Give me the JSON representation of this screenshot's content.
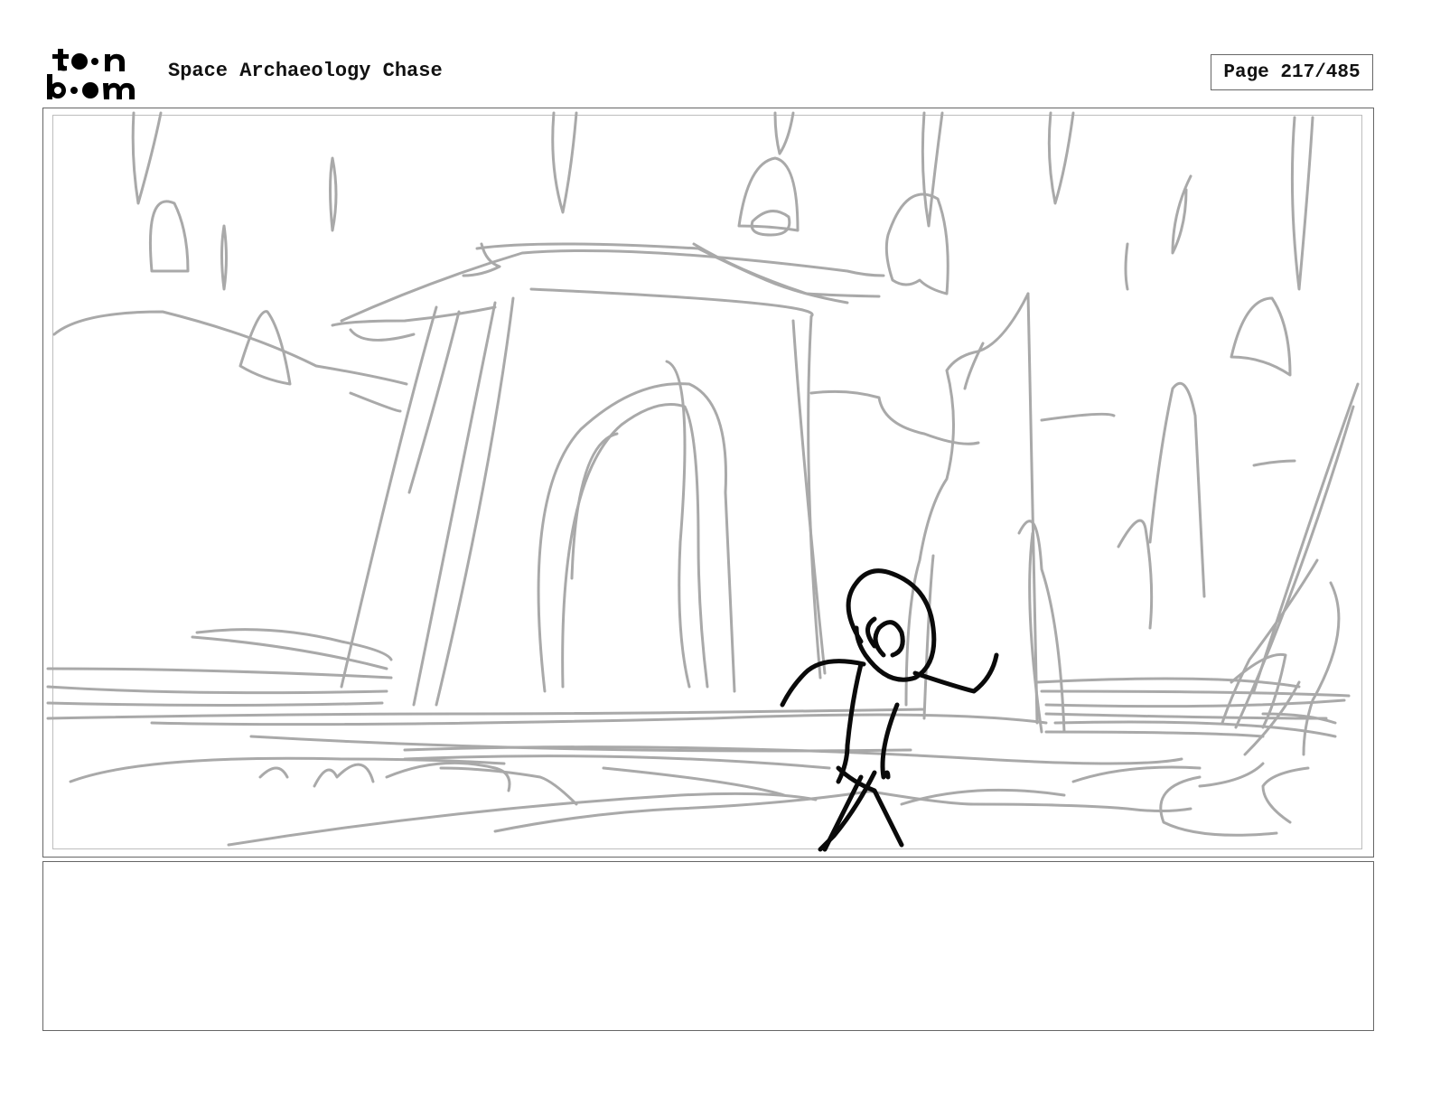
{
  "header": {
    "logo_text": "toon boom",
    "title": "Space Archaeology Chase",
    "page_label": "Page 217/485"
  },
  "panel": {
    "background_sketch": "grey-rough",
    "character_sketch": "black-line"
  },
  "notes": {
    "text": ""
  },
  "colors": {
    "sketch_grey": "#a9a9a9",
    "ink_black": "#0a0a0a",
    "border": "#666666"
  }
}
